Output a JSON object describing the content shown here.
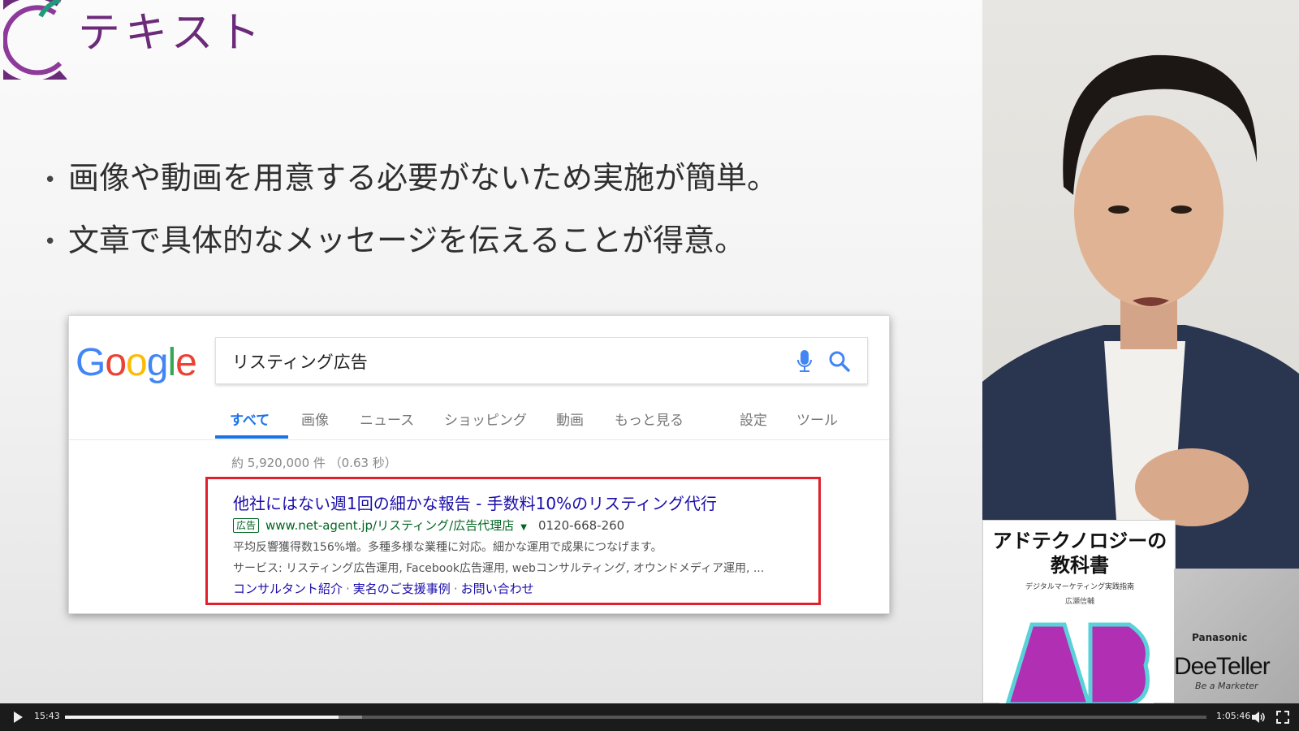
{
  "slide": {
    "title": "テキスト",
    "bullets": [
      "画像や動画を用意する必要がないため実施が簡単。",
      "文章で具体的なメッセージを伝えることが得意。"
    ]
  },
  "google": {
    "logo_letters": [
      "G",
      "o",
      "o",
      "g",
      "l",
      "e"
    ],
    "logo_colors": [
      "#4285F4",
      "#EA4335",
      "#FBBC05",
      "#4285F4",
      "#34A853",
      "#EA4335"
    ],
    "query": "リスティング広告",
    "tabs": [
      "すべて",
      "画像",
      "ニュース",
      "ショッピング",
      "動画",
      "もっと見る",
      "設定",
      "ツール"
    ],
    "active_tab": "すべて",
    "stats": "約 5,920,000 件 （0.63 秒）",
    "ad": {
      "title": "他社にはない週1回の細かな報告 - 手数料10%のリスティング代行",
      "badge": "広告",
      "url": "www.net-agent.jp/リスティング/広告代理店",
      "phone": "0120-668-260",
      "description": "平均反響獲得数156%増。多種多様な業種に対応。細かな運用で成果につなげます。",
      "services": "サービス: リスティング広告運用, Facebook広告運用, webコンサルティング, オウンドメディア運用, ...",
      "links": [
        "コンサルタント紹介",
        "実名のご支援事例",
        "お問い合わせ"
      ]
    },
    "accent_color": "#1a73e8",
    "highlight_color": "#e0202a"
  },
  "speaker": {
    "book_title_line1": "アドテクノロジーの",
    "book_title_line2": "教科書",
    "book_subtitle": "デジタルマーケティング実践指南",
    "book_author": "広瀬信輔",
    "laptop_brand": "Panasonic",
    "laptop_sticker": "DeeTeller",
    "laptop_tag": "Be a Marketer"
  },
  "player": {
    "current_time": "15:43",
    "total_time": "1:05:46",
    "played_fraction": 0.24,
    "buffered_fraction": 0.26
  }
}
